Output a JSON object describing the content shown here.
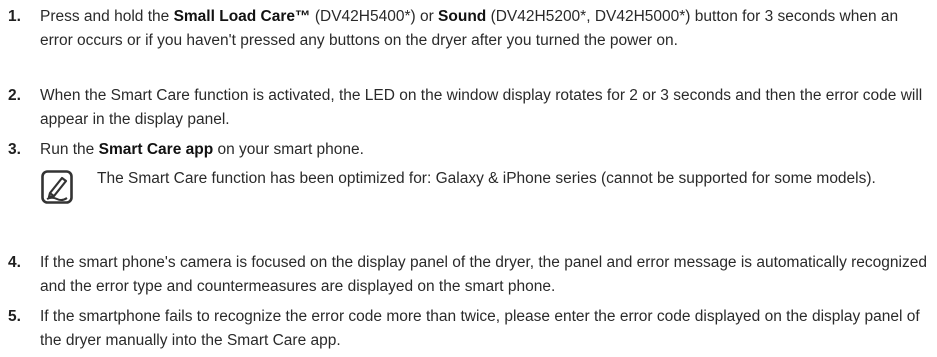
{
  "steps": [
    {
      "number": "1.",
      "parts": [
        {
          "text": "Press and hold the ",
          "bold": false
        },
        {
          "text": "Small Load Care™",
          "bold": true
        },
        {
          "text": " (DV42H5400*) or ",
          "bold": false
        },
        {
          "text": "Sound",
          "bold": true
        },
        {
          "text": " (DV42H5200*, DV42H5000*) button for 3 seconds when an error occurs or if you haven't pressed any buttons on the dryer after you turned the power on.",
          "bold": false
        }
      ]
    },
    {
      "number": "2.",
      "parts": [
        {
          "text": "When the Smart Care function is activated, the LED on the window display rotates for 2 or 3 seconds and then the error code will appear in the display panel.",
          "bold": false
        }
      ]
    },
    {
      "number": "3.",
      "parts": [
        {
          "text": "Run the ",
          "bold": false
        },
        {
          "text": "Smart Care app",
          "bold": true
        },
        {
          "text": " on your smart phone.",
          "bold": false
        }
      ]
    },
    {
      "number": "4.",
      "parts": [
        {
          "text": "If the smart phone's camera is focused on the display panel of the dryer, the panel and error message is automatically recognized and the error type and countermeasures are displayed on the smart phone.",
          "bold": false
        }
      ]
    },
    {
      "number": "5.",
      "parts": [
        {
          "text": "If the smartphone fails to recognize the error code more than twice, please enter the error code displayed on the display panel of the dryer manually into the Smart Care app.",
          "bold": false
        }
      ]
    }
  ],
  "note": {
    "icon": "note-pencil-icon",
    "text": "The Smart Care function has been optimized for: Galaxy & iPhone series (cannot be supported for some models)."
  }
}
